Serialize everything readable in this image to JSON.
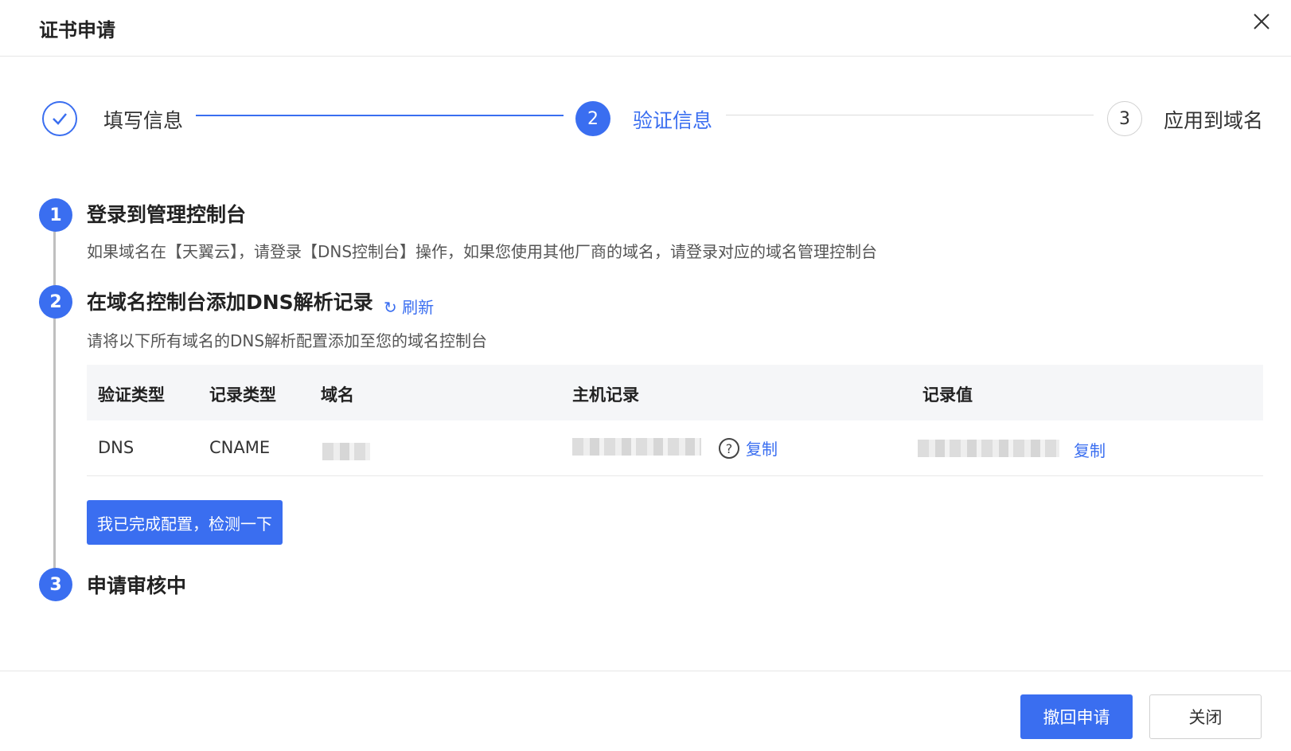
{
  "dialog": {
    "title": "证书申请"
  },
  "steps": [
    {
      "label": "填写信息",
      "status": "done"
    },
    {
      "number": "2",
      "label": "验证信息",
      "status": "active"
    },
    {
      "number": "3",
      "label": "应用到域名",
      "status": "pending"
    }
  ],
  "sections": [
    {
      "number": "1",
      "title": "登录到管理控制台",
      "desc": "如果域名在【天翼云】，请登录【DNS控制台】操作，如果您使用其他厂商的域名，请登录对应的域名管理控制台"
    },
    {
      "number": "2",
      "title": "在域名控制台添加DNS解析记录",
      "refresh_label": "刷新",
      "desc": "请将以下所有域名的DNS解析配置添加至您的域名控制台"
    },
    {
      "number": "3",
      "title": "申请审核中"
    }
  ],
  "table": {
    "columns": [
      "验证类型",
      "记录类型",
      "域名",
      "主机记录",
      "记录值"
    ],
    "rows": [
      {
        "verify_type": "DNS",
        "record_type": "CNAME",
        "copy_host": "复制",
        "copy_value": "复制"
      }
    ]
  },
  "check_button": "我已完成配置，检测一下",
  "footer": {
    "revoke_label": "撤回申请",
    "close_label": "关闭"
  },
  "colors": {
    "accent": "#3a6ef0"
  }
}
